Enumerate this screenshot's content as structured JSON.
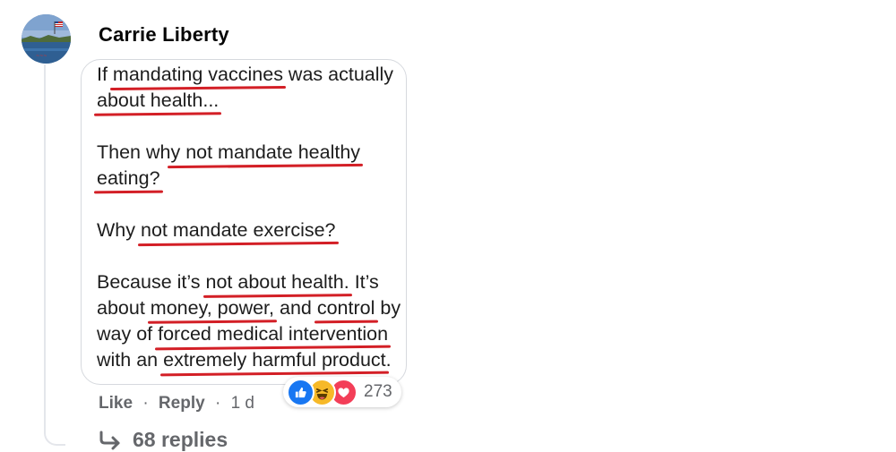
{
  "comment": {
    "author": "Carrie Liberty",
    "meme": {
      "paragraphs": [
        [
          [
            {
              "t": "If "
            },
            {
              "t": "mandating vaccines",
              "u": true
            },
            {
              "t": " was actually"
            }
          ],
          [
            {
              "t": "about health...",
              "u": true
            }
          ]
        ],
        [
          [
            {
              "t": "Then wh"
            },
            {
              "t": "y not mandate healthy",
              "u": true
            }
          ],
          [
            {
              "t": "eating?",
              "u": true
            }
          ]
        ],
        [
          [
            {
              "t": "Why "
            },
            {
              "t": "not mandate exercise?",
              "u": true
            }
          ]
        ],
        [
          [
            {
              "t": "Because it’s "
            },
            {
              "t": "not about health.",
              "u": true
            },
            {
              "t": " It’s"
            }
          ],
          [
            {
              "t": "about "
            },
            {
              "t": "money, power,",
              "u": true
            },
            {
              "t": " and "
            },
            {
              "t": "control",
              "u": true
            },
            {
              "t": " by"
            }
          ],
          [
            {
              "t": "way of "
            },
            {
              "t": "forced medical intervention",
              "u": true
            }
          ],
          [
            {
              "t": "with an "
            },
            {
              "t": "extremely harmful product",
              "u": true
            },
            {
              "t": "."
            }
          ]
        ]
      ]
    },
    "actions": {
      "like": "Like",
      "reply": "Reply",
      "separator": "·",
      "time": "1 d"
    },
    "reactions": {
      "icons": [
        "like-icon",
        "haha-icon",
        "love-icon"
      ],
      "count": "273",
      "colors": {
        "like": "#1877f2",
        "haha": "#f7b928",
        "love": "#f33e58"
      }
    },
    "replies_label": "68 replies"
  }
}
